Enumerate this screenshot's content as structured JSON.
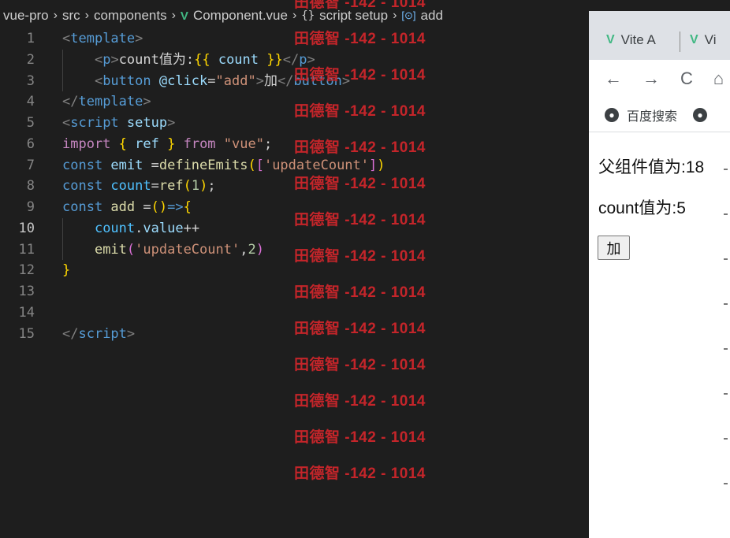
{
  "breadcrumb": {
    "items": [
      "vue-pro",
      "src",
      "components",
      "Component.vue",
      "script setup",
      "add"
    ],
    "braces": "{}"
  },
  "editor": {
    "active_line": 10,
    "lines": [
      {
        "n": "1",
        "parts": [
          [
            "t-punc",
            "<"
          ],
          [
            "t-tag",
            "template"
          ],
          [
            "t-punc",
            ">"
          ]
        ]
      },
      {
        "n": "2",
        "indent": true,
        "parts": [
          [
            "t-punc",
            "    <"
          ],
          [
            "t-tag",
            "p"
          ],
          [
            "t-punc",
            ">"
          ],
          [
            "t-text",
            "count值为:"
          ],
          [
            "t-b1",
            "{{"
          ],
          [
            "t-var",
            " count "
          ],
          [
            "t-b1",
            "}}"
          ],
          [
            "t-punc",
            "</"
          ],
          [
            "t-tag",
            "p"
          ],
          [
            "t-punc",
            ">"
          ]
        ]
      },
      {
        "n": "3",
        "indent": true,
        "parts": [
          [
            "t-punc",
            "    <"
          ],
          [
            "t-tag",
            "button"
          ],
          [
            "t-attr",
            " @click"
          ],
          [
            "t-text",
            "="
          ],
          [
            "t-str",
            "\"add\""
          ],
          [
            "t-punc",
            ">"
          ],
          [
            "t-text",
            "加"
          ],
          [
            "t-punc",
            "</"
          ],
          [
            "t-tag",
            "button"
          ],
          [
            "t-punc",
            ">"
          ]
        ]
      },
      {
        "n": "4",
        "parts": [
          [
            "t-punc",
            "</"
          ],
          [
            "t-tag",
            "template"
          ],
          [
            "t-punc",
            ">"
          ]
        ]
      },
      {
        "n": "5",
        "parts": [
          [
            "t-punc",
            "<"
          ],
          [
            "t-tag",
            "script"
          ],
          [
            "t-attr",
            " setup"
          ],
          [
            "t-punc",
            ">"
          ]
        ]
      },
      {
        "n": "6",
        "parts": [
          [
            "t-kw",
            "import"
          ],
          [
            "t-text",
            " "
          ],
          [
            "t-b1",
            "{"
          ],
          [
            "t-var",
            " ref "
          ],
          [
            "t-b1",
            "}"
          ],
          [
            "t-kw",
            " from"
          ],
          [
            "t-str",
            " \"vue\""
          ],
          [
            "t-text",
            ";"
          ]
        ]
      },
      {
        "n": "7",
        "parts": [
          [
            "t-decl",
            "const"
          ],
          [
            "t-var",
            " emit "
          ],
          [
            "t-text",
            "="
          ],
          [
            "t-fn",
            "defineEmits"
          ],
          [
            "t-b1",
            "("
          ],
          [
            "t-b2",
            "["
          ],
          [
            "t-str",
            "'updateCount'"
          ],
          [
            "t-b2",
            "]"
          ],
          [
            "t-b1",
            ")"
          ]
        ]
      },
      {
        "n": "8",
        "parts": [
          [
            "t-decl",
            "const"
          ],
          [
            "t-const",
            " count"
          ],
          [
            "t-text",
            "="
          ],
          [
            "t-fn",
            "ref"
          ],
          [
            "t-b1",
            "("
          ],
          [
            "t-num",
            "1"
          ],
          [
            "t-b1",
            ")"
          ],
          [
            "t-text",
            ";"
          ]
        ]
      },
      {
        "n": "9",
        "parts": [
          [
            "t-decl",
            "const"
          ],
          [
            "t-fn",
            " add"
          ],
          [
            "t-text",
            " ="
          ],
          [
            "t-b1",
            "("
          ],
          [
            "t-b1",
            ")"
          ],
          [
            "t-decl",
            "=>"
          ],
          [
            "t-b1",
            "{"
          ]
        ]
      },
      {
        "n": "10",
        "indent": true,
        "parts": [
          [
            "t-text",
            "    "
          ],
          [
            "t-const",
            "count"
          ],
          [
            "t-text",
            "."
          ],
          [
            "t-var",
            "value"
          ],
          [
            "t-text",
            "++"
          ]
        ]
      },
      {
        "n": "11",
        "indent": true,
        "parts": [
          [
            "t-text",
            "    "
          ],
          [
            "t-fn",
            "emit"
          ],
          [
            "t-b2",
            "("
          ],
          [
            "t-str",
            "'updateCount'"
          ],
          [
            "t-text",
            ","
          ],
          [
            "t-num",
            "2"
          ],
          [
            "t-b2",
            ")"
          ]
        ]
      },
      {
        "n": "12",
        "parts": [
          [
            "t-b1",
            "}"
          ]
        ]
      },
      {
        "n": "13",
        "parts": []
      },
      {
        "n": "14",
        "parts": []
      },
      {
        "n": "15",
        "parts": [
          [
            "t-punc",
            "</"
          ],
          [
            "t-tag",
            "script"
          ],
          [
            "t-punc",
            ">"
          ]
        ]
      }
    ]
  },
  "watermark": {
    "text": "田德智 -142 - 1014",
    "count": 14
  },
  "browser": {
    "tabs": [
      "Vite A",
      "Vi"
    ],
    "nav": {
      "back": "←",
      "forward": "→",
      "reload": "C",
      "home": "⌂"
    },
    "bookmark": "百度搜索",
    "parent_value_text": "父组件值为:18",
    "count_text": "count值为:5",
    "add_button": "加"
  },
  "colors": {
    "editor_bg": "#1e1e1e",
    "vue_green": "#41b883",
    "watermark_red": "#c4252a"
  }
}
